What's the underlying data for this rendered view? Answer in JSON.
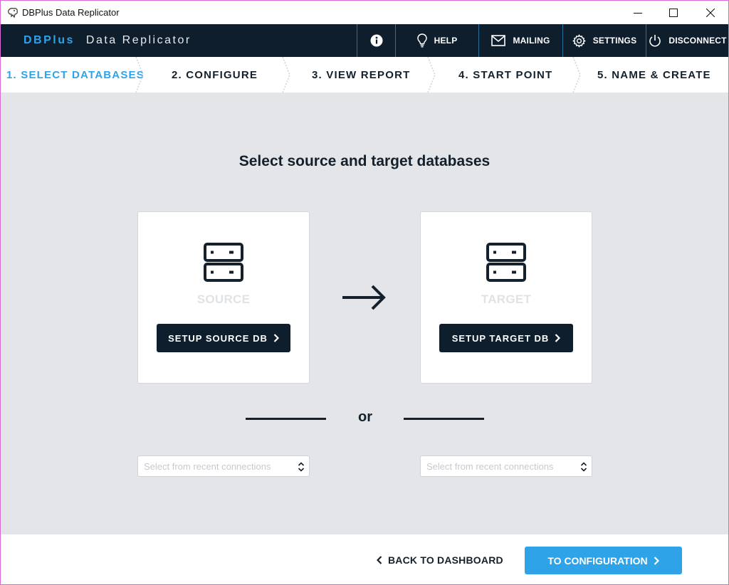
{
  "window": {
    "title": "DBPlus Data Replicator",
    "controls": [
      "minimize-icon",
      "maximize-icon",
      "close-icon"
    ]
  },
  "nav": {
    "brand_primary": "DBPlus",
    "brand_secondary": "Data Replicator",
    "buttons": [
      {
        "icon": "info-icon",
        "label": ""
      },
      {
        "icon": "lightbulb-icon",
        "label": "HELP"
      },
      {
        "icon": "envelope-icon",
        "label": "MAILING"
      },
      {
        "icon": "gear-icon",
        "label": "SETTINGS"
      },
      {
        "icon": "power-icon",
        "label": "DISCONNECT"
      }
    ]
  },
  "steps": [
    {
      "label": "1. SELECT DATABASES",
      "active": true
    },
    {
      "label": "2. CONFIGURE",
      "active": false
    },
    {
      "label": "3. VIEW REPORT",
      "active": false
    },
    {
      "label": "4. START POINT",
      "active": false
    },
    {
      "label": "5. NAME & CREATE",
      "active": false
    }
  ],
  "main": {
    "heading": "Select source and target databases",
    "source": {
      "label": "SOURCE",
      "button": "SETUP SOURCE DB",
      "icon": "database-server-icon"
    },
    "target": {
      "label": "TARGET",
      "button": "SETUP TARGET DB",
      "icon": "database-server-icon"
    },
    "arrow_icon": "arrow-right-icon",
    "or_text": "or",
    "source_recent_placeholder": "Select from recent connections",
    "target_recent_placeholder": "Select from recent connections"
  },
  "footer": {
    "back_label": "BACK TO DASHBOARD",
    "next_label": "TO CONFIGURATION"
  },
  "colors": {
    "accent": "#2ea3e8",
    "dark": "#0e1e2c",
    "background": "#e3e5e8"
  }
}
